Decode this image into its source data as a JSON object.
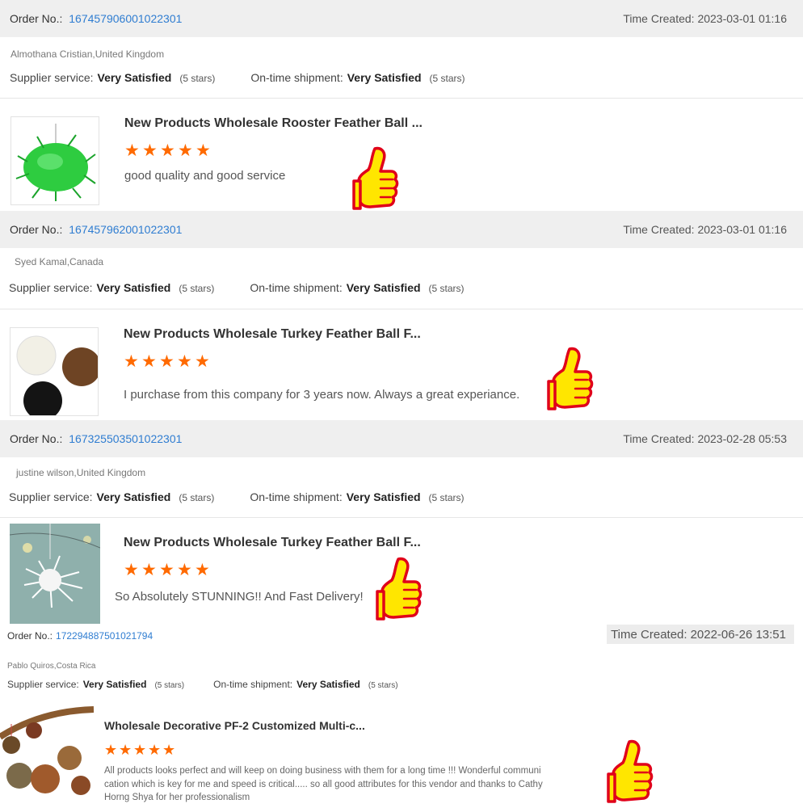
{
  "labels": {
    "order_no": "Order No.:",
    "time_created": "Time Created:",
    "supplier_service": "Supplier service:",
    "on_time_shipment": "On-time shipment:"
  },
  "reviews": [
    {
      "order_no": "167457906001022301",
      "time": "2023-03-01 01:16",
      "buyer": "Almothana Cristian,United Kingdom",
      "supplier_rating": "Very Satisfied",
      "supplier_stars": "(5 stars)",
      "shipment_rating": "Very Satisfied",
      "shipment_stars": "(5 stars)",
      "product_title": "New Products Wholesale Rooster Feather Ball ...",
      "rating": 5,
      "comment": "good quality and good service"
    },
    {
      "order_no": "167457962001022301",
      "time": "2023-03-01 01:16",
      "buyer": "Syed Kamal,Canada",
      "supplier_rating": "Very Satisfied",
      "supplier_stars": "(5 stars)",
      "shipment_rating": "Very Satisfied",
      "shipment_stars": "(5 stars)",
      "product_title": "New Products Wholesale Turkey Feather Ball F...",
      "rating": 5,
      "comment": "I purchase from this company for 3 years now. Always a great experiance."
    },
    {
      "order_no": "167325503501022301",
      "time": "2023-02-28 05:53",
      "buyer": "justine wilson,United Kingdom",
      "supplier_rating": "Very Satisfied",
      "supplier_stars": "(5 stars)",
      "shipment_rating": "Very Satisfied",
      "shipment_stars": "(5 stars)",
      "product_title": "New Products Wholesale Turkey Feather Ball F...",
      "rating": 5,
      "comment": "So Absolutely STUNNING!! And Fast Delivery!"
    },
    {
      "order_no": "172294887501021794",
      "time": "2022-06-26 13:51",
      "buyer": "Pablo Quiros,Costa Rica",
      "supplier_rating": "Very Satisfied",
      "supplier_stars": "(5 stars)",
      "shipment_rating": "Very Satisfied",
      "shipment_stars": "(5 stars)",
      "product_title": "Wholesale Decorative PF-2 Customized Multi-c...",
      "rating": 5,
      "comment_lines": [
        "All products looks perfect and will keep on doing business with them for a long time !!! Wonderful communi",
        "cation which is key for me and speed is critical..... so all good attributes for this vendor and thanks to Cathy",
        "Horng Shya for her professionalism"
      ]
    }
  ],
  "colors": {
    "accent_link": "#2f7dd1",
    "star": "#ff6a00",
    "thumbs_up_fill": "#ffe600",
    "thumbs_up_stroke": "#e0001a"
  },
  "icons": {
    "star": "star-icon",
    "thumbs_up": "thumbs-up-icon"
  }
}
